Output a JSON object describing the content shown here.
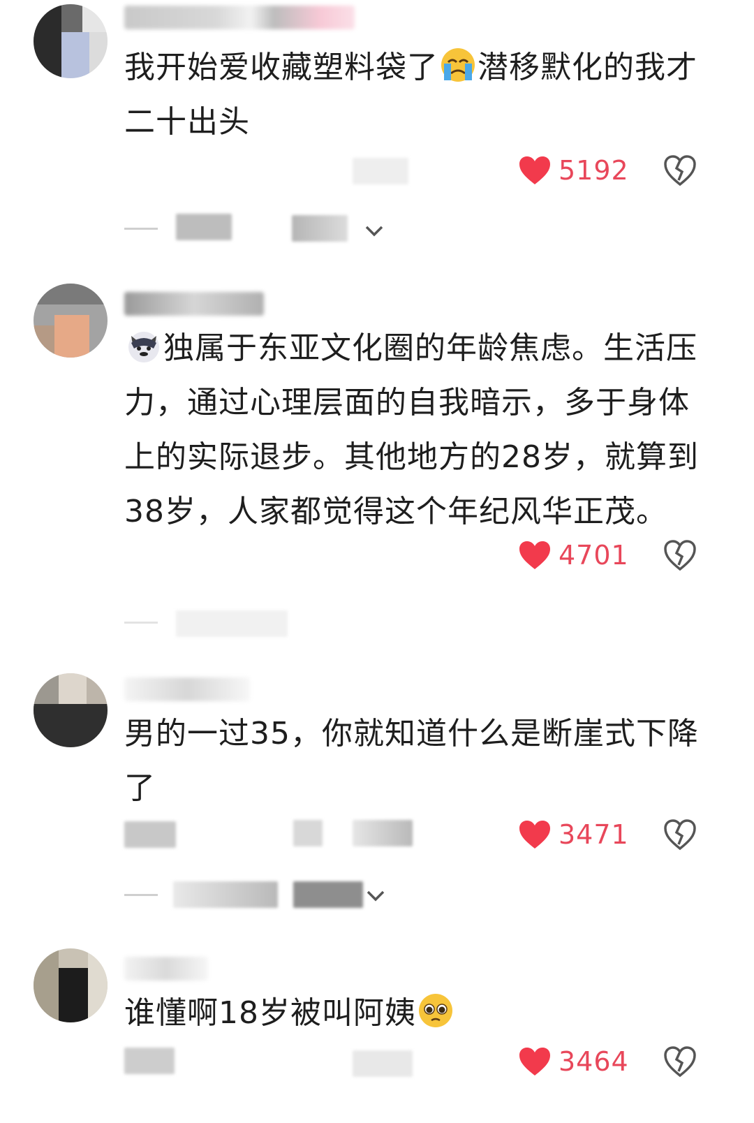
{
  "comments": [
    {
      "text_parts": [
        "我开始爱收藏塑料袋了",
        "潜移默化的我才二十出头"
      ],
      "emoji": "crying-face-emoji",
      "likes": "5192"
    },
    {
      "lead_emoji": "wolf-face-emoji",
      "text": "独属于东亚文化圈的年龄焦虑。生活压力，通过心理层面的自我暗示，多于身体上的实际退步。其他地方的28岁，就算到38岁，人家都觉得这个年纪风华正茂。",
      "likes": "4701"
    },
    {
      "text": "男的一过35，你就知道什么是断崖式下降了",
      "likes": "3471"
    },
    {
      "text": "谁懂啊18岁被叫阿姨",
      "emoji": "pleading-face-emoji",
      "likes": "3464"
    }
  ],
  "colors": {
    "like_red": "#e8475a",
    "text": "#1e1e1e",
    "muted": "#cfcfcf"
  },
  "icons": {
    "like": "heart-icon",
    "dislike": "broken-heart-icon",
    "expand": "chevron-down-icon"
  }
}
